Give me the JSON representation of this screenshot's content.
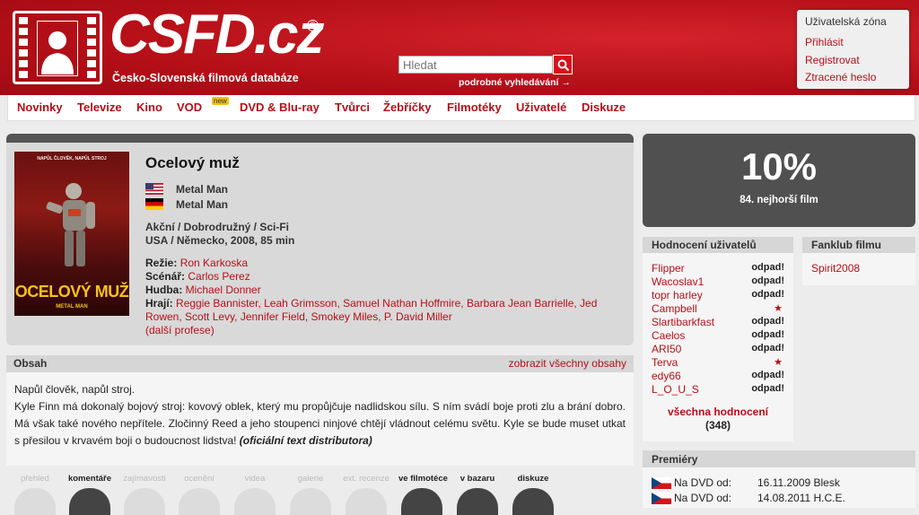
{
  "header": {
    "logo": "CSFD.cz",
    "logo_reg": "®",
    "subtitle": "Česko-Slovenská filmová databáze",
    "search_placeholder": "Hledat",
    "advanced_search": "podrobné vyhledávání →",
    "user_zone": {
      "title": "Uživatelská zóna",
      "links": [
        "Přihlásit",
        "Registrovat",
        "Ztracené heslo"
      ]
    }
  },
  "nav": {
    "items": [
      "Novinky",
      "Televize",
      "Kino",
      "VOD",
      "DVD & Blu-ray",
      "Tvůrci",
      "Žebříčky",
      "Filmotéky",
      "Uživatelé",
      "Diskuze"
    ],
    "vod_badge": "new"
  },
  "film": {
    "title": "Ocelový muž",
    "names": [
      {
        "flag": "us-flag-icon",
        "name": "Metal Man"
      },
      {
        "flag": "de-flag-icon",
        "name": "Metal Man"
      }
    ],
    "genres": "Akční / Dobrodružný / Sci-Fi",
    "origin": "USA / Německo, 2008, 85 min",
    "director_label": "Režie:",
    "director": "Ron Karkoska",
    "writer_label": "Scénář:",
    "writer": "Carlos Perez",
    "music_label": "Hudba:",
    "music": "Michael Donner",
    "cast_label": "Hrají:",
    "cast": "Reggie Bannister, Leah Grimsson, Samuel Nathan Hoffmire, Barbara Jean Barrielle, Jed Rowen, Scott Levy, Jennifer Field, Smokey Miles, P. David Miller",
    "more_professions": "(další profese)",
    "poster": {
      "tagline": "NAPŮL ČLOVĚK, NAPŮL STROJ",
      "title": "OCELOVÝ MUŽ",
      "subtitle": "METAL MAN"
    }
  },
  "rating": {
    "percent": "10%",
    "rank": "84. nejhorší film"
  },
  "plot": {
    "heading": "Obsah",
    "show_all": "zobrazit všechny obsahy",
    "line1": "Napůl člověk, napůl stroj.",
    "text": "Kyle Finn má dokonalý bojový stroj: kovový oblek, který mu propůjčuje nadlidskou sílu. S ním svádí boje proti zlu a brání dobro. Má však také nového nepřítele. Zločinný Reed a jeho stoupenci ninjové chtějí vládnout celému světu. Kyle se bude muset utkat s přesilou v krvavém boji o budoucnost lidstva!",
    "source": "(oficiální text distributora)"
  },
  "tabs": [
    "přehled",
    "komentáře",
    "zajímavosti",
    "ocenění",
    "videa",
    "galerie",
    "ext. recenze",
    "ve filmotéce",
    "v bazaru",
    "diskuze"
  ],
  "user_ratings": {
    "heading": "Hodnocení uživatelů",
    "rows": [
      {
        "user": "Flipper",
        "value": "odpad!"
      },
      {
        "user": "Wacoslav1",
        "value": "odpad!"
      },
      {
        "user": "topr harley",
        "value": "odpad!"
      },
      {
        "user": "Campbell",
        "value": "★"
      },
      {
        "user": "Slartibarkfast",
        "value": "odpad!"
      },
      {
        "user": "Caelos",
        "value": "odpad!"
      },
      {
        "user": "ARI50",
        "value": "odpad!"
      },
      {
        "user": "Terva",
        "value": "★"
      },
      {
        "user": "edy66",
        "value": "odpad!"
      },
      {
        "user": "L_O_U_S",
        "value": "odpad!"
      }
    ],
    "all": "všechna hodnocení",
    "count": "(348)"
  },
  "fanclub": {
    "heading": "Fanklub filmu",
    "members": [
      "Spirit2008"
    ]
  },
  "premieres": {
    "heading": "Premiéry",
    "rows": [
      {
        "label": "Na DVD od:",
        "date": "16.11.2009 Blesk"
      },
      {
        "label": "Na DVD od:",
        "date": "14.08.2011 H.C.E."
      }
    ]
  },
  "colors": {
    "brand_red": "#c4111b",
    "link_red": "#b50f18",
    "rating_bg": "#505050"
  }
}
